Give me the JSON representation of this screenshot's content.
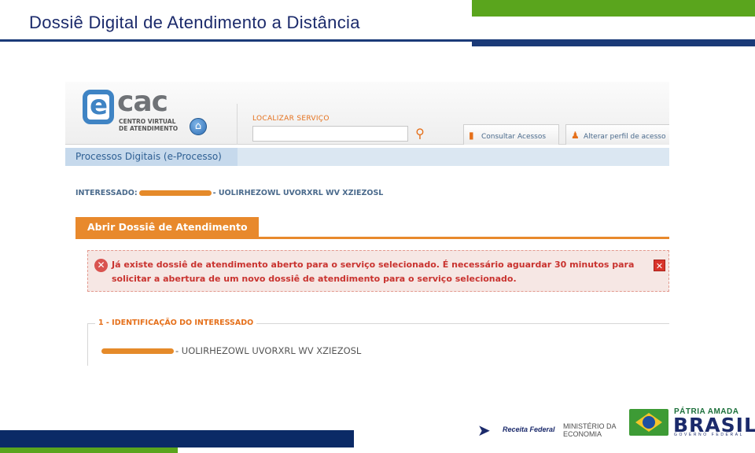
{
  "slide": {
    "title": "Dossiê Digital de Atendimento a Distância"
  },
  "ecac": {
    "logo": {
      "e": "e",
      "cac": "cac",
      "subtitle": "CENTRO VIRTUAL DE ATENDIMENTO"
    },
    "search_label": "LOCALIZAR SERVIÇO",
    "search_value": "",
    "buttons": {
      "consultar_acessos": "Consultar Acessos",
      "alterar_perfil": "Alterar perfil de acesso"
    },
    "nav_tab": "Processos Digitais (e-Processo)",
    "interessado_label": "INTERESSADO:",
    "interessado_name": "- UOLIRHEZOWL UVORXRL WV XZIEZOSL",
    "section_tab": "Abrir Dossiê de Atendimento",
    "error_message": "Já existe dossiê de atendimento aberto para o serviço selecionado. É necessário aguardar 30 minutos para solicitar a abertura de um novo dossiê de atendimento para o serviço selecionado.",
    "fieldset_legend": "1 - IDENTIFICAÇÃO DO INTERESSADO",
    "ident_name": "- UOLIRHEZOWL UVORXRL WV XZIEZOSL"
  },
  "footer": {
    "receita": "Receita Federal",
    "ministerio": [
      "MINISTÉRIO DA",
      "ECONOMIA"
    ],
    "patria": "PÁTRIA AMADA",
    "brasil": "BRASIL",
    "governo": "GOVERNO FEDERAL"
  },
  "colors": {
    "title_navy": "#1b2a6b",
    "accent_green": "#5aa51d",
    "ecac_orange": "#e8892c",
    "error_red": "#c9332f"
  }
}
